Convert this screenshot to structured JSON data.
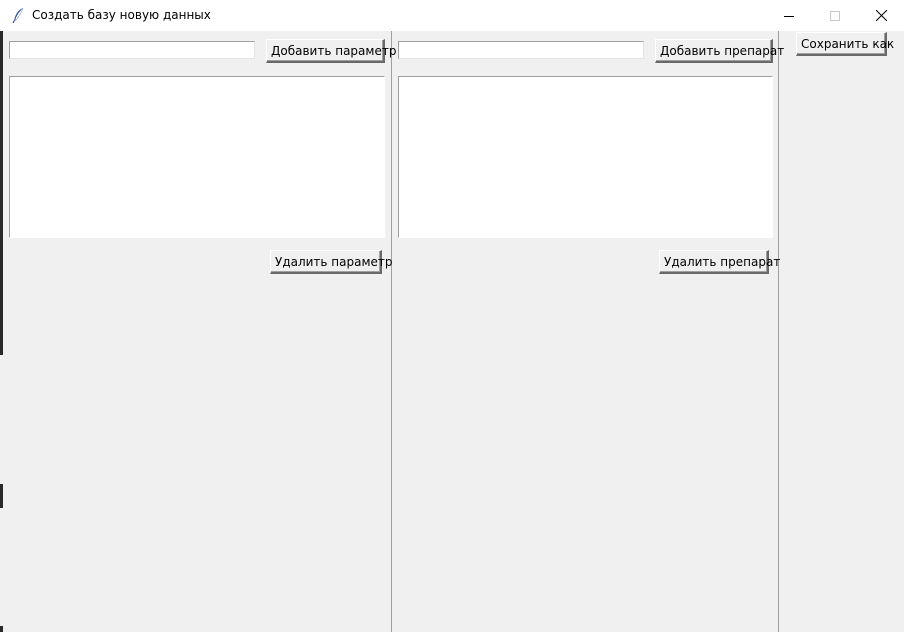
{
  "window": {
    "title": "Создать базу новую данных",
    "icon": "feather-icon"
  },
  "controls": {
    "minimize_icon": "minimize-icon",
    "maximize_icon": "maximize-icon",
    "close_icon": "close-icon"
  },
  "left_panel": {
    "entry_value": "",
    "add_button": "Добавить параметр",
    "delete_button": "Удалить параметр",
    "items": []
  },
  "middle_panel": {
    "entry_value": "",
    "add_button": "Добавить препарат",
    "delete_button": "Удалить препарат",
    "items": []
  },
  "right_panel": {
    "save_button": "Сохранить как"
  }
}
